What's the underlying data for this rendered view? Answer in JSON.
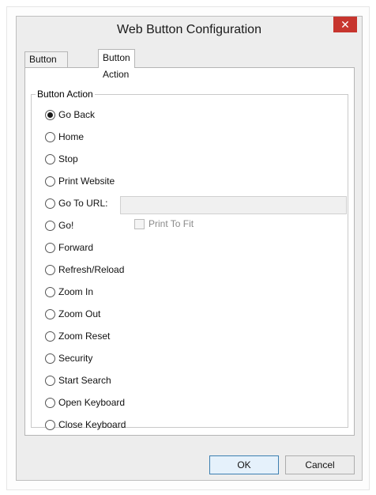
{
  "window": {
    "title": "Web Button Configuration",
    "close_glyph": "✕"
  },
  "tabs": [
    {
      "label": "Button Settings",
      "selected": false
    },
    {
      "label": "Button Action",
      "selected": true
    }
  ],
  "group": {
    "legend": "Button Action"
  },
  "options": [
    {
      "label": "Go Back",
      "checked": true
    },
    {
      "label": "Home",
      "checked": false
    },
    {
      "label": "Stop",
      "checked": false
    },
    {
      "label": "Print Website",
      "checked": false
    },
    {
      "label": "Go To URL:",
      "checked": false
    },
    {
      "label": "Go!",
      "checked": false
    },
    {
      "label": "Forward",
      "checked": false
    },
    {
      "label": "Refresh/Reload",
      "checked": false
    },
    {
      "label": "Zoom In",
      "checked": false
    },
    {
      "label": "Zoom Out",
      "checked": false
    },
    {
      "label": "Zoom Reset",
      "checked": false
    },
    {
      "label": "Security",
      "checked": false
    },
    {
      "label": "Start Search",
      "checked": false
    },
    {
      "label": "Open Keyboard",
      "checked": false
    },
    {
      "label": "Close Keyboard",
      "checked": false
    }
  ],
  "print_to_fit": {
    "label": "Print To Fit",
    "checked": false,
    "enabled": false
  },
  "url_field": {
    "value": "",
    "enabled": false
  },
  "buttons": {
    "ok_label": "OK",
    "cancel_label": "Cancel"
  },
  "colors": {
    "close_button": "#c7352e",
    "ok_border": "#3c7fb1"
  }
}
